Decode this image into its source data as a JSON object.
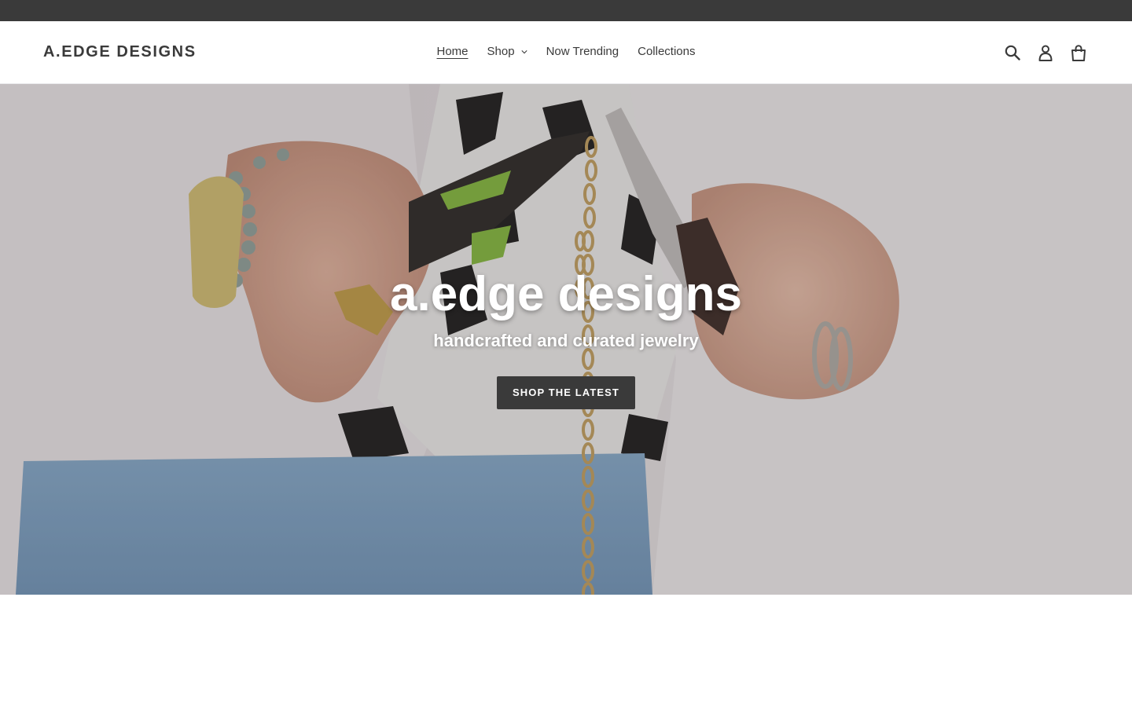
{
  "header": {
    "logo": "A.EDGE DESIGNS",
    "nav": [
      {
        "label": "Home",
        "active": true
      },
      {
        "label": "Shop",
        "has_dropdown": true
      },
      {
        "label": "Now Trending"
      },
      {
        "label": "Collections"
      }
    ],
    "icons": [
      "search-icon",
      "account-icon",
      "cart-icon"
    ]
  },
  "hero": {
    "title": "a.edge designs",
    "subtitle": "handcrafted and curated jewelry",
    "button_label": "SHOP THE LATEST"
  },
  "colors": {
    "announcement_bar": "#3a3a3a",
    "text": "#3a3a3a",
    "button_bg": "#3a3a3a",
    "button_text": "#ffffff"
  }
}
